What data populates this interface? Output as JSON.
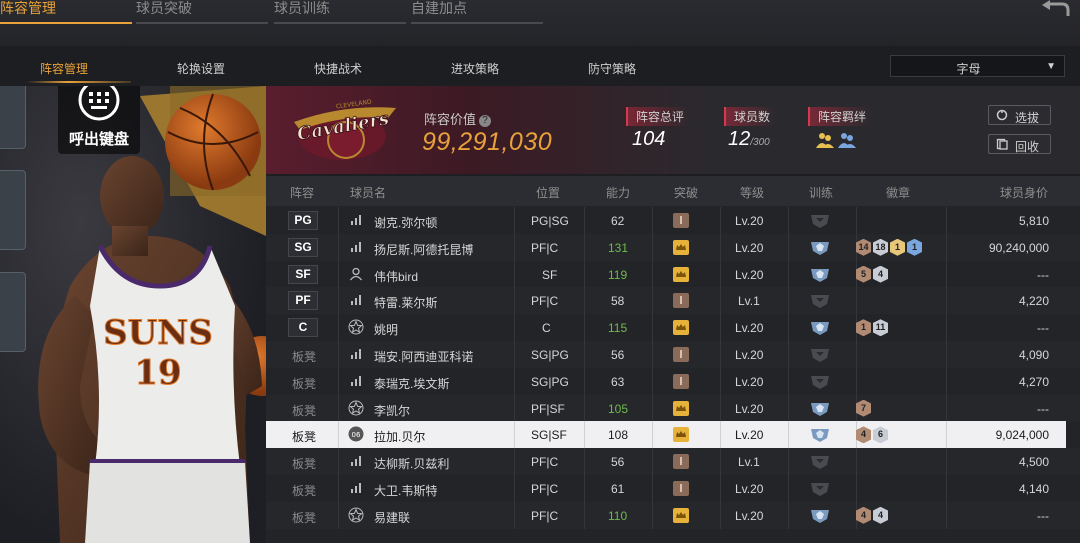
{
  "top_tabs": [
    {
      "label": "阵容管理",
      "active": true
    },
    {
      "label": "球员突破",
      "active": false
    },
    {
      "label": "球员训练",
      "active": false
    },
    {
      "label": "自建加点",
      "active": false
    }
  ],
  "sub_tabs": [
    {
      "label": "阵容管理",
      "active": true
    },
    {
      "label": "轮换设置",
      "active": false
    },
    {
      "label": "快捷战术",
      "active": false
    },
    {
      "label": "进攻策略",
      "active": false
    },
    {
      "label": "防守策略",
      "active": false
    }
  ],
  "sort_select": {
    "value": "字母"
  },
  "keyboard_button": {
    "label": "呼出键盘"
  },
  "team": {
    "value_label": "阵容价值",
    "value": "99,291,030",
    "rating_label": "阵容总评",
    "rating": "104",
    "players_label": "球员数",
    "players": "12",
    "players_max": "/300",
    "bond_label": "阵容羁绊"
  },
  "buttons": {
    "pick": "选拔",
    "recycle": "回收"
  },
  "table": {
    "headers": [
      "阵容",
      "球员名",
      "位置",
      "能力",
      "突破",
      "等级",
      "训练",
      "徽章",
      "球员身价"
    ],
    "rows": [
      {
        "slot": "PG",
        "name": "谢克.弥尔顿",
        "pos": "PG|SG",
        "ability": "62",
        "ability_up": false,
        "rank": "bronze",
        "level": "Lv.20",
        "level_dim": false,
        "train": "gray",
        "badges": [],
        "price": "5,810",
        "icon": "bars"
      },
      {
        "slot": "SG",
        "name": "扬尼斯.阿德托昆博",
        "pos": "PF|C",
        "ability": "131",
        "ability_up": true,
        "rank": "gold",
        "level": "Lv.20",
        "level_dim": false,
        "train": "blue",
        "badges": [
          {
            "v": "14",
            "c": "#b08a72"
          },
          {
            "v": "18",
            "c": "#c8ccd4"
          },
          {
            "v": "1",
            "c": "#e8c77a"
          },
          {
            "v": "1",
            "c": "#7aa6e0"
          }
        ],
        "price": "90,240,000",
        "icon": "bars"
      },
      {
        "slot": "SF",
        "name": "伟伟bird",
        "pos": "SF",
        "ability": "119",
        "ability_up": true,
        "rank": "gold",
        "level": "Lv.20",
        "level_dim": false,
        "train": "blue",
        "badges": [
          {
            "v": "5",
            "c": "#b08a72"
          },
          {
            "v": "4",
            "c": "#c8ccd4"
          }
        ],
        "price": "---",
        "icon": "person"
      },
      {
        "slot": "PF",
        "name": "特雷.莱尔斯",
        "pos": "PF|C",
        "ability": "58",
        "ability_up": false,
        "rank": "bronze",
        "level": "Lv.1",
        "level_dim": false,
        "train": "gray",
        "badges": [],
        "price": "4,220",
        "icon": "bars"
      },
      {
        "slot": "C",
        "name": "姚明",
        "pos": "C",
        "ability": "115",
        "ability_up": true,
        "rank": "gold",
        "level": "Lv.20",
        "level_dim": false,
        "train": "blue",
        "badges": [
          {
            "v": "1",
            "c": "#b08a72"
          },
          {
            "v": "11",
            "c": "#c8ccd4"
          }
        ],
        "price": "---",
        "icon": "star"
      },
      {
        "slot": "板凳",
        "name": "瑞安.阿西迪亚科诺",
        "pos": "SG|PG",
        "ability": "56",
        "ability_up": false,
        "rank": "bronze",
        "level": "Lv.20",
        "level_dim": false,
        "train": "gray",
        "badges": [],
        "price": "4,090",
        "icon": "bars"
      },
      {
        "slot": "板凳",
        "name": "泰瑞克.埃文斯",
        "pos": "SG|PG",
        "ability": "63",
        "ability_up": false,
        "rank": "bronze",
        "level": "Lv.20",
        "level_dim": false,
        "train": "gray",
        "badges": [],
        "price": "4,270",
        "icon": "bars"
      },
      {
        "slot": "板凳",
        "name": "李凯尔",
        "pos": "PF|SF",
        "ability": "105",
        "ability_up": true,
        "rank": "gold",
        "level": "Lv.20",
        "level_dim": false,
        "train": "blue",
        "badges": [
          {
            "v": "7",
            "c": "#b08a72"
          }
        ],
        "price": "---",
        "icon": "star"
      },
      {
        "slot": "板凳",
        "name": "拉加.贝尔",
        "pos": "SG|SF",
        "ability": "108",
        "ability_up": false,
        "rank": "gold",
        "level": "Lv.20",
        "level_dim": false,
        "train": "blue",
        "badges": [
          {
            "v": "4",
            "c": "#b08a72"
          },
          {
            "v": "6",
            "c": "#c8ccd4"
          }
        ],
        "price": "9,024,000",
        "icon": "ring06",
        "selected": true
      },
      {
        "slot": "板凳",
        "name": "达柳斯.贝兹利",
        "pos": "PF|C",
        "ability": "56",
        "ability_up": false,
        "rank": "bronze",
        "level": "Lv.1",
        "level_dim": false,
        "train": "gray",
        "badges": [],
        "price": "4,500",
        "icon": "bars"
      },
      {
        "slot": "板凳",
        "name": "大卫.韦斯特",
        "pos": "PF|C",
        "ability": "61",
        "ability_up": false,
        "rank": "bronze",
        "level": "Lv.20",
        "level_dim": false,
        "train": "gray",
        "badges": [],
        "price": "4,140",
        "icon": "bars"
      },
      {
        "slot": "板凳",
        "name": "易建联",
        "pos": "PF|C",
        "ability": "110",
        "ability_up": true,
        "rank": "gold",
        "level": "Lv.20",
        "level_dim": false,
        "train": "blue",
        "badges": [
          {
            "v": "4",
            "c": "#b08a72"
          },
          {
            "v": "4",
            "c": "#c8ccd4"
          }
        ],
        "price": "---",
        "icon": "star"
      }
    ]
  },
  "colors": {
    "accent": "#e8a23a",
    "up_green": "#6dbb4b",
    "team_maroon": "#5a1d2e"
  },
  "icons": [
    "back-icon",
    "keyboard-icon",
    "help-icon",
    "pick-icon",
    "recycle-icon",
    "bond-icon",
    "dropdown-arrow-icon"
  ]
}
